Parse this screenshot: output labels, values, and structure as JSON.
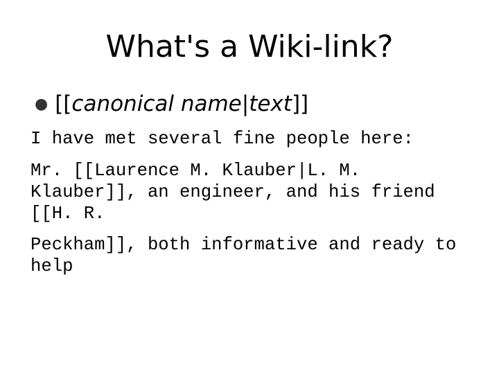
{
  "slide": {
    "title": "What's a Wiki-link?",
    "bullet": {
      "open": "[[",
      "italic_1": "canonical name",
      "separator": "|",
      "italic_2": "text",
      "close": "]]"
    },
    "paragraphs": [
      "I have met several fine people here:",
      "Mr. [[Laurence M. Klauber|L. M.",
      "Klauber]], an engineer, and his friend",
      "[[H. R.",
      "Peckham]], both informative and ready to",
      "help"
    ]
  }
}
